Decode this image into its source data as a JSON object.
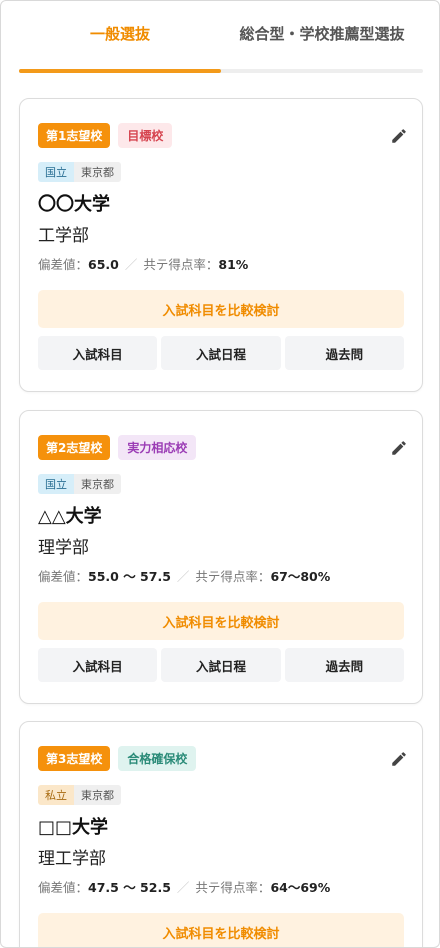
{
  "tabs": [
    {
      "label": "一般選抜",
      "active": true
    },
    {
      "label": "総合型・学校推薦型選抜",
      "active": false
    }
  ],
  "labels": {
    "hensachi": "偏差値：",
    "kyotsu": "共テ得点率：",
    "compare_button": "入試科目を比較検討",
    "action_subjects": "入試科目",
    "action_schedule": "入試日程",
    "action_past": "過去問"
  },
  "colors": {
    "accent": "#f39a1a",
    "rank_badge": "#f5910c",
    "target": "#d64550",
    "match": "#9b3db5",
    "safe": "#2a8b78"
  },
  "icons": {
    "edit": "pencil-icon"
  },
  "cards": [
    {
      "rank": "第1志望校",
      "kind": "目標校",
      "type": "国立",
      "prefecture": "東京都",
      "university": "〇〇大学",
      "faculty": "工学部",
      "hensachi": "65.0",
      "kyotsu": "81%"
    },
    {
      "rank": "第2志望校",
      "kind": "実力相応校",
      "type": "国立",
      "prefecture": "東京都",
      "university": "△△大学",
      "faculty": "理学部",
      "hensachi": "55.0 〜 57.5",
      "kyotsu": "67〜80%"
    },
    {
      "rank": "第3志望校",
      "kind": "合格確保校",
      "type": "私立",
      "prefecture": "東京都",
      "university": "□□大学",
      "faculty": "理工学部",
      "hensachi": "47.5 〜 52.5",
      "kyotsu": "64〜69%"
    }
  ]
}
